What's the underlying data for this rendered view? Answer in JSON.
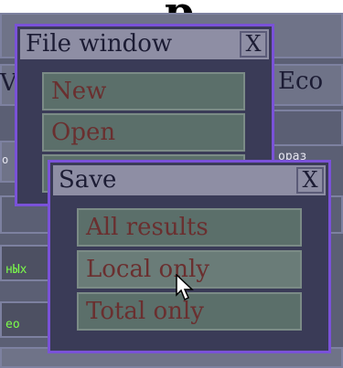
{
  "background": {
    "heading_fragment": "p",
    "right_tab": "Eco",
    "left_fragment": "V",
    "mid_fragment": "ораз",
    "green_left_1": "нЫх",
    "green_left_2": "ео",
    "left_mark": "о"
  },
  "file_window": {
    "title": "File window",
    "close_label": "X",
    "items": [
      {
        "label": "New"
      },
      {
        "label": "Open"
      }
    ]
  },
  "save_window": {
    "title": "Save",
    "close_label": "X",
    "items": [
      {
        "label": "All results"
      },
      {
        "label": "Local only"
      },
      {
        "label": "Total only"
      }
    ]
  },
  "colors": {
    "window_border": "#7a52d8",
    "window_body": "#3a3b57",
    "titlebar": "#8e8ea4",
    "button_face": "#5b6f6a",
    "button_text": "#6a2f2f"
  }
}
